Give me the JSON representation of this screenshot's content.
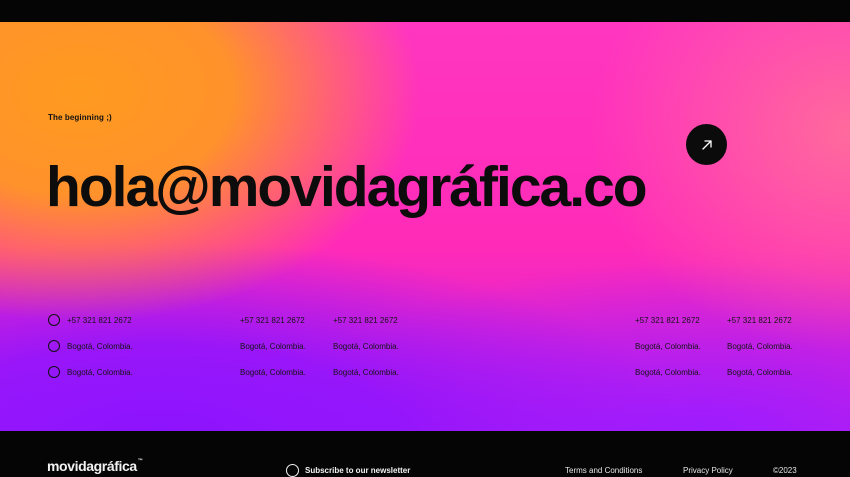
{
  "hero": {
    "tagline": "The beginning ;)",
    "email": "hola@movidagráfica.co",
    "arrow_icon": "arrow-up-right-icon"
  },
  "contacts": {
    "col1": {
      "phone": "+57 321 821 2672",
      "city1": "Bogotá, Colombia.",
      "city2": "Bogotá, Colombia."
    },
    "col2": {
      "phone": "+57 321 821 2672",
      "city1": "Bogotá, Colombia.",
      "city2": "Bogotá, Colombia."
    },
    "col3": {
      "phone": "+57 321 821 2672",
      "city1": "Bogotá, Colombia.",
      "city2": "Bogotá, Colombia."
    },
    "col4": {
      "phone": "+57 321 821 2672",
      "city1": "Bogotá, Colombia.",
      "city2": "Bogotá, Colombia."
    },
    "col5": {
      "phone": "+57 321 821 2672",
      "city1": "Bogotá, Colombia.",
      "city2": "Bogotá, Colombia."
    }
  },
  "footer": {
    "logo": "movidagráfica",
    "trademark": "™",
    "newsletter": "Subscribe to our newsletter",
    "terms": "Terms and Conditions",
    "privacy": "Privacy Policy",
    "copyright": "©2023"
  },
  "colors": {
    "orange": "#ff9a1f",
    "pink": "#ff36c0",
    "purple": "#8d14ff",
    "ink": "#0c0c0c"
  }
}
